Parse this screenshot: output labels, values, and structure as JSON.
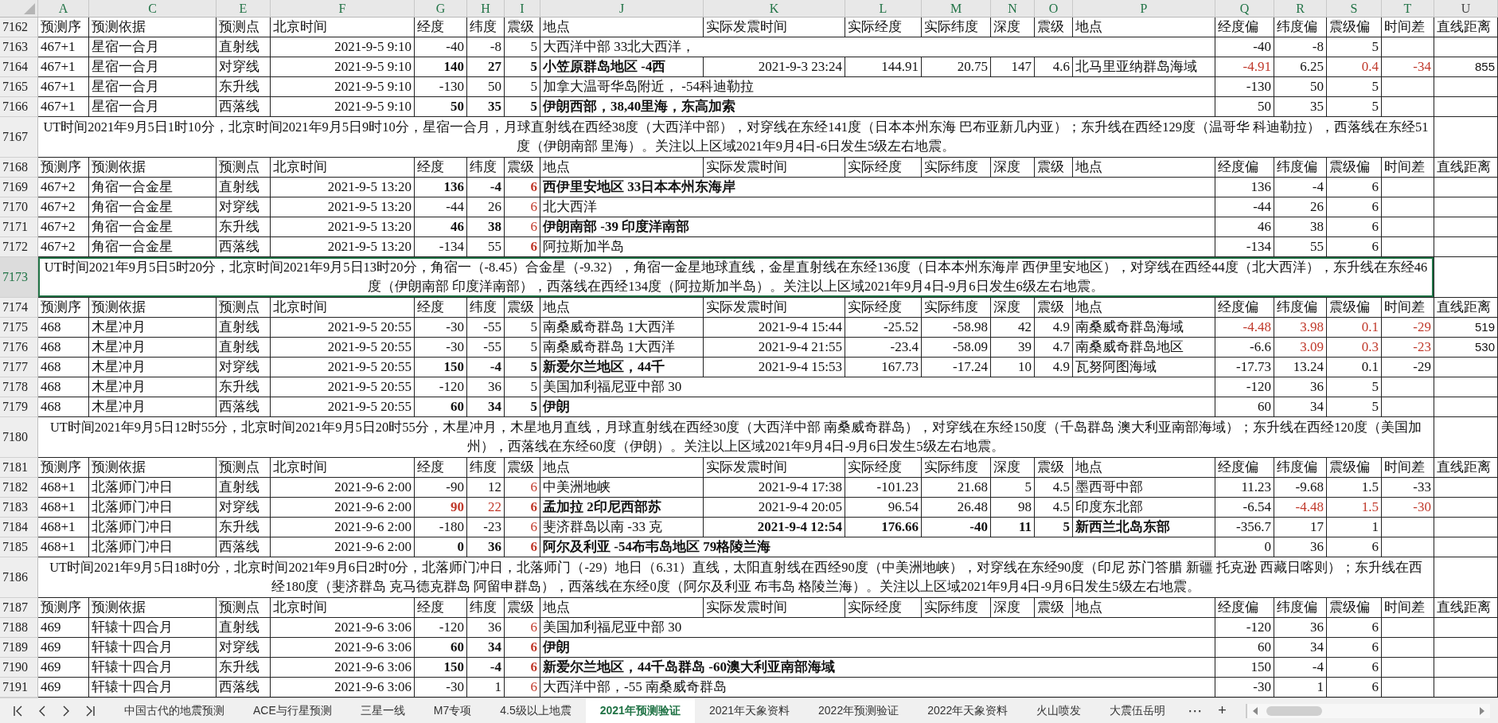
{
  "columns": [
    {
      "letter": "A",
      "selected": true
    },
    {
      "letter": "C",
      "selected": true
    },
    {
      "letter": "E",
      "selected": true
    },
    {
      "letter": "F",
      "selected": true
    },
    {
      "letter": "G",
      "selected": true
    },
    {
      "letter": "H",
      "selected": true
    },
    {
      "letter": "I",
      "selected": true
    },
    {
      "letter": "J",
      "selected": true
    },
    {
      "letter": "K",
      "selected": true
    },
    {
      "letter": "L",
      "selected": true
    },
    {
      "letter": "M",
      "selected": true
    },
    {
      "letter": "N",
      "selected": true
    },
    {
      "letter": "O",
      "selected": true
    },
    {
      "letter": "P",
      "selected": true
    },
    {
      "letter": "Q",
      "selected": true
    },
    {
      "letter": "R",
      "selected": true
    },
    {
      "letter": "S",
      "selected": true
    },
    {
      "letter": "T",
      "selected": true
    },
    {
      "letter": "U",
      "selected": false
    }
  ],
  "sections": [
    {
      "header": {
        "row": "7162",
        "cells": {
          "A": "预测序",
          "C": "预测依据",
          "E": "预测点",
          "F": "北京时间",
          "G": "经度",
          "H": "纬度",
          "I": "震级",
          "J": "地点",
          "K": "实际发震时间",
          "L": "实际经度",
          "M": "实际纬度",
          "N": "深度",
          "O": "震级",
          "P": "地点",
          "Q": "经度偏",
          "R": "纬度偏",
          "S": "震级偏",
          "T": "时间差",
          "U": "直线距离"
        }
      },
      "rows": [
        {
          "row": "7163",
          "cells": {
            "A": "467+1",
            "C": "星宿一合月",
            "E": "直射线",
            "F": "2021-9-5 9:10",
            "G": "-40",
            "H": "-8",
            "I": "5",
            "J": "大西洋中部 33北大西洋，",
            "Q": "-40",
            "R": "-8",
            "S": "5"
          }
        },
        {
          "row": "7164",
          "cells": {
            "A": "467+1",
            "C": "星宿一合月",
            "E": "对穿线",
            "F": "2021-9-5 9:10",
            "G": "140",
            "H": "27",
            "I": "5",
            "J": "小笠原群岛地区 -4西",
            "K": "2021-9-3 23:24",
            "L": "144.91",
            "M": "20.75",
            "N": "147",
            "O": "4.6",
            "P": "北马里亚纳群岛海域",
            "Q": "-4.91",
            "R": "6.25",
            "S": "0.4",
            "T": "-34",
            "U": "855"
          },
          "bold": {
            "G": true,
            "H": true,
            "I": true,
            "J": true
          },
          "red": {
            "Q": true,
            "S": true,
            "T": true
          }
        },
        {
          "row": "7165",
          "cells": {
            "A": "467+1",
            "C": "星宿一合月",
            "E": "东升线",
            "F": "2021-9-5 9:10",
            "G": "-130",
            "H": "50",
            "I": "5",
            "J": "加拿大温哥华岛附近， -54科迪勒拉",
            "Q": "-130",
            "R": "50",
            "S": "5"
          }
        },
        {
          "row": "7166",
          "cells": {
            "A": "467+1",
            "C": "星宿一合月",
            "E": "西落线",
            "F": "2021-9-5 9:10",
            "G": "50",
            "H": "35",
            "I": "5",
            "J": "伊朗西部，38,40里海，东高加索",
            "Q": "50",
            "R": "35",
            "S": "5"
          },
          "bold": {
            "G": true,
            "H": true,
            "I": true,
            "J": true
          }
        }
      ],
      "note": {
        "row": "7167",
        "text": "UT时间2021年9月5日1时10分，北京时间2021年9月5日9时10分，星宿一合月，月球直射线在西经38度（大西洋中部），对穿线在东经141度（日本本州东海 巴布亚新几内亚）；东升线在西经129度（温哥华 科迪勒拉），西落线在东经51度（伊朗南部 里海）。关注以上区域2021年9月4日-6日发生5级左右地震。",
        "selected": false
      }
    },
    {
      "header": {
        "row": "7168",
        "cells": {
          "A": "预测序",
          "C": "预测依据",
          "E": "预测点",
          "F": "北京时间",
          "G": "经度",
          "H": "纬度",
          "I": "震级",
          "J": "地点",
          "K": "实际发震时间",
          "L": "实际经度",
          "M": "实际纬度",
          "N": "深度",
          "O": "震级",
          "P": "地点",
          "Q": "经度偏",
          "R": "纬度偏",
          "S": "震级偏",
          "T": "时间差",
          "U": "直线距离"
        }
      },
      "rows": [
        {
          "row": "7169",
          "cells": {
            "A": "467+2",
            "C": "角宿一合金星",
            "E": "直射线",
            "F": "2021-9-5 13:20",
            "G": "136",
            "H": "-4",
            "I": "6",
            "J": "西伊里安地区 33日本本州东海岸",
            "Q": "136",
            "R": "-4",
            "S": "6"
          },
          "bold": {
            "G": true,
            "H": true,
            "I": true,
            "J": true
          },
          "red": {
            "I": true
          }
        },
        {
          "row": "7170",
          "cells": {
            "A": "467+2",
            "C": "角宿一合金星",
            "E": "对穿线",
            "F": "2021-9-5 13:20",
            "G": "-44",
            "H": "26",
            "I": "6",
            "J": "北大西洋",
            "Q": "-44",
            "R": "26",
            "S": "6"
          },
          "red": {
            "I": true
          }
        },
        {
          "row": "7171",
          "cells": {
            "A": "467+2",
            "C": "角宿一合金星",
            "E": "东升线",
            "F": "2021-9-5 13:20",
            "G": "46",
            "H": "38",
            "I": "6",
            "J": "伊朗南部 -39 印度洋南部",
            "Q": "46",
            "R": "38",
            "S": "6"
          },
          "bold": {
            "G": true,
            "H": true,
            "J": true
          },
          "red": {
            "I": true
          }
        },
        {
          "row": "7172",
          "cells": {
            "A": "467+2",
            "C": "角宿一合金星",
            "E": "西落线",
            "F": "2021-9-5 13:20",
            "G": "-134",
            "H": "55",
            "I": "6",
            "J": "阿拉斯加半岛",
            "Q": "-134",
            "R": "55",
            "S": "6"
          },
          "bold": {
            "I": true
          },
          "red": {
            "I": true
          }
        }
      ],
      "note": {
        "row": "7173",
        "text": "UT时间2021年9月5日5时20分，北京时间2021年9月5日13时20分，角宿一（-8.45）合金星（-9.32），角宿一金星地球直线，金星直射线在东经136度（日本本州东海岸 西伊里安地区），对穿线在西经44度（北大西洋），东升线在东经46度（伊朗南部 印度洋南部），西落线在西经134度（阿拉斯加半岛）。关注以上区域2021年9月4日-9月6日发生6级左右地震。",
        "selected": true
      }
    },
    {
      "header": {
        "row": "7174",
        "cells": {
          "A": "预测序",
          "C": "预测依据",
          "E": "预测点",
          "F": "北京时间",
          "G": "经度",
          "H": "纬度",
          "I": "震级",
          "J": "地点",
          "K": "实际发震时间",
          "L": "实际经度",
          "M": "实际纬度",
          "N": "深度",
          "O": "震级",
          "P": "地点",
          "Q": "经度偏",
          "R": "纬度偏",
          "S": "震级偏",
          "T": "时间差",
          "U": "直线距离"
        }
      },
      "rows": [
        {
          "row": "7175",
          "cells": {
            "A": "468",
            "C": "木星冲月",
            "E": "直射线",
            "F": "2021-9-5 20:55",
            "G": "-30",
            "H": "-55",
            "I": "5",
            "J": "南桑威奇群岛 1大西洋",
            "K": "2021-9-4 15:44",
            "L": "-25.52",
            "M": "-58.98",
            "N": "42",
            "O": "4.9",
            "P": "南桑威奇群岛海域",
            "Q": "-4.48",
            "R": "3.98",
            "S": "0.1",
            "T": "-29",
            "U": "519"
          },
          "red": {
            "Q": true,
            "R": true,
            "S": true,
            "T": true
          }
        },
        {
          "row": "7176",
          "cells": {
            "A": "468",
            "C": "木星冲月",
            "E": "直射线",
            "F": "2021-9-5 20:55",
            "G": "-30",
            "H": "-55",
            "I": "5",
            "J": "南桑威奇群岛 1大西洋",
            "K": "2021-9-4 21:55",
            "L": "-23.4",
            "M": "-58.09",
            "N": "39",
            "O": "4.7",
            "P": "南桑威奇群岛地区",
            "Q": "-6.6",
            "R": "3.09",
            "S": "0.3",
            "T": "-23",
            "U": "530"
          },
          "red": {
            "R": true,
            "S": true,
            "T": true
          }
        },
        {
          "row": "7177",
          "cells": {
            "A": "468",
            "C": "木星冲月",
            "E": "对穿线",
            "F": "2021-9-5 20:55",
            "G": "150",
            "H": "-4",
            "I": "5",
            "J": "新爱尔兰地区，44千",
            "K": "2021-9-4 15:53",
            "L": "167.73",
            "M": "-17.24",
            "N": "10",
            "O": "4.9",
            "P": "瓦努阿图海域",
            "Q": "-17.73",
            "R": "13.24",
            "S": "0.1",
            "T": "-29"
          },
          "bold": {
            "G": true,
            "H": true,
            "I": true,
            "J": true
          }
        },
        {
          "row": "7178",
          "cells": {
            "A": "468",
            "C": "木星冲月",
            "E": "东升线",
            "F": "2021-9-5 20:55",
            "G": "-120",
            "H": "36",
            "I": "5",
            "J": "美国加利福尼亚中部 30",
            "Q": "-120",
            "R": "36",
            "S": "5"
          }
        },
        {
          "row": "7179",
          "cells": {
            "A": "468",
            "C": "木星冲月",
            "E": "西落线",
            "F": "2021-9-5 20:55",
            "G": "60",
            "H": "34",
            "I": "5",
            "J": "伊朗",
            "Q": "60",
            "R": "34",
            "S": "5"
          },
          "bold": {
            "G": true,
            "H": true,
            "I": true,
            "J": true
          }
        }
      ],
      "note": {
        "row": "7180",
        "text": "UT时间2021年9月5日12时55分，北京时间2021年9月5日20时55分，木星冲月，木星地月直线，月球直射线在西经30度（大西洋中部 南桑威奇群岛），对穿线在东经150度（千岛群岛 澳大利亚南部海域）；东升线在西经120度（美国加州），西落线在东经60度（伊朗）。关注以上区域2021年9月4日-9月6日发生5级左右地震。",
        "selected": false
      }
    },
    {
      "header": {
        "row": "7181",
        "cells": {
          "A": "预测序",
          "C": "预测依据",
          "E": "预测点",
          "F": "北京时间",
          "G": "经度",
          "H": "纬度",
          "I": "震级",
          "J": "地点",
          "K": "实际发震时间",
          "L": "实际经度",
          "M": "实际纬度",
          "N": "深度",
          "O": "震级",
          "P": "地点",
          "Q": "经度偏",
          "R": "纬度偏",
          "S": "震级偏",
          "T": "时间差",
          "U": "直线距离"
        }
      },
      "rows": [
        {
          "row": "7182",
          "cells": {
            "A": "468+1",
            "C": "北落师门冲日",
            "E": "直射线",
            "F": "2021-9-6 2:00",
            "G": "-90",
            "H": "12",
            "I": "6",
            "J": "中美洲地峡",
            "K": "2021-9-4 17:38",
            "L": "-101.23",
            "M": "21.68",
            "N": "5",
            "O": "4.5",
            "P": "墨西哥中部",
            "Q": "11.23",
            "R": "-9.68",
            "S": "1.5",
            "T": "-33"
          },
          "red": {
            "I": true
          }
        },
        {
          "row": "7183",
          "cells": {
            "A": "468+1",
            "C": "北落师门冲日",
            "E": "对穿线",
            "F": "2021-9-6 2:00",
            "G": "90",
            "H": "22",
            "I": "6",
            "J": "孟加拉 2印尼西部苏",
            "K": "2021-9-4 20:05",
            "L": "96.54",
            "M": "26.48",
            "N": "98",
            "O": "4.5",
            "P": "印度东北部",
            "Q": "-6.54",
            "R": "-4.48",
            "S": "1.5",
            "T": "-30"
          },
          "bold": {
            "G": true,
            "I": true,
            "J": true
          },
          "red": {
            "G": true,
            "H": true,
            "I": true,
            "R": true,
            "S": true,
            "T": true
          }
        },
        {
          "row": "7184",
          "cells": {
            "A": "468+1",
            "C": "北落师门冲日",
            "E": "东升线",
            "F": "2021-9-6 2:00",
            "G": "-180",
            "H": "-23",
            "I": "6",
            "J": "斐济群岛以南 -33 克",
            "K": "2021-9-4 12:54",
            "L": "176.66",
            "M": "-40",
            "N": "11",
            "O": "5",
            "P": "新西兰北岛东部",
            "Q": "-356.7",
            "R": "17",
            "S": "1"
          },
          "bold": {
            "K": true,
            "L": true,
            "M": true,
            "N": true,
            "O": true,
            "P": true
          },
          "red": {
            "I": true
          }
        },
        {
          "row": "7185",
          "cells": {
            "A": "468+1",
            "C": "北落师门冲日",
            "E": "西落线",
            "F": "2021-9-6 2:00",
            "G": "0",
            "H": "36",
            "I": "6",
            "J": "阿尔及利亚 -54布韦岛地区 79格陵兰海",
            "Q": "0",
            "R": "36",
            "S": "6"
          },
          "bold": {
            "G": true,
            "H": true,
            "I": true,
            "J": true
          },
          "red": {
            "I": true
          }
        }
      ],
      "note": {
        "row": "7186",
        "text": "UT时间2021年9月5日18时0分，北京时间2021年9月6日2时0分，北落师门冲日，北落师门（-29）地日（6.31）直线，太阳直射线在西经90度（中美洲地峡），对穿线在东经90度（印尼 苏门答腊 新疆 托克逊 西藏日喀则）；东升线在西经180度（斐济群岛 克马德克群岛 阿留申群岛），西落线在东经0度（阿尔及利亚 布韦岛 格陵兰海）。关注以上区域2021年9月4日-9月6日发生5级左右地震。",
        "selected": false
      }
    },
    {
      "header": {
        "row": "7187",
        "cells": {
          "A": "预测序",
          "C": "预测依据",
          "E": "预测点",
          "F": "北京时间",
          "G": "经度",
          "H": "纬度",
          "I": "震级",
          "J": "地点",
          "K": "实际发震时间",
          "L": "实际经度",
          "M": "实际纬度",
          "N": "深度",
          "O": "震级",
          "P": "地点",
          "Q": "经度偏",
          "R": "纬度偏",
          "S": "震级偏",
          "T": "时间差",
          "U": "直线距离"
        }
      },
      "rows": [
        {
          "row": "7188",
          "cells": {
            "A": "469",
            "C": "轩辕十四合月",
            "E": "直射线",
            "F": "2021-9-6 3:06",
            "G": "-120",
            "H": "36",
            "I": "6",
            "J": "美国加利福尼亚中部 30",
            "Q": "-120",
            "R": "36",
            "S": "6"
          },
          "red": {
            "I": true
          }
        },
        {
          "row": "7189",
          "cells": {
            "A": "469",
            "C": "轩辕十四合月",
            "E": "对穿线",
            "F": "2021-9-6 3:06",
            "G": "60",
            "H": "34",
            "I": "6",
            "J": "伊朗",
            "Q": "60",
            "R": "34",
            "S": "6"
          },
          "bold": {
            "G": true,
            "H": true,
            "I": true,
            "J": true
          },
          "red": {
            "I": true
          }
        },
        {
          "row": "7190",
          "cells": {
            "A": "469",
            "C": "轩辕十四合月",
            "E": "东升线",
            "F": "2021-9-6 3:06",
            "G": "150",
            "H": "-4",
            "I": "6",
            "J": "新爱尔兰地区，44千岛群岛 -60澳大利亚南部海域",
            "Q": "150",
            "R": "-4",
            "S": "6"
          },
          "bold": {
            "G": true,
            "H": true,
            "I": true,
            "J": true
          },
          "red": {
            "I": true
          }
        },
        {
          "row": "7191",
          "cells": {
            "A": "469",
            "C": "轩辕十四合月",
            "E": "西落线",
            "F": "2021-9-6 3:06",
            "G": "-30",
            "H": "1",
            "I": "6",
            "J": "大西洋中部，-55 南桑威奇群岛",
            "Q": "-30",
            "R": "1",
            "S": "6"
          },
          "red": {
            "I": true
          }
        }
      ]
    }
  ],
  "sheet_tabs": [
    {
      "label": "中国古代的地震预测",
      "selected": false
    },
    {
      "label": "ACE与行星预测",
      "selected": false
    },
    {
      "label": "三星一线",
      "selected": false
    },
    {
      "label": "M7专项",
      "selected": false
    },
    {
      "label": "4.5级以上地震",
      "selected": false
    },
    {
      "label": "2021年预测验证",
      "selected": true
    },
    {
      "label": "2021年天象资料",
      "selected": false
    },
    {
      "label": "2022年预测验证",
      "selected": false
    },
    {
      "label": "2022年天象资料",
      "selected": false
    },
    {
      "label": "火山喷发",
      "selected": false
    },
    {
      "label": "大震伍岳明",
      "selected": false
    }
  ],
  "more_tabs": "⋯",
  "add_sheet": "+"
}
